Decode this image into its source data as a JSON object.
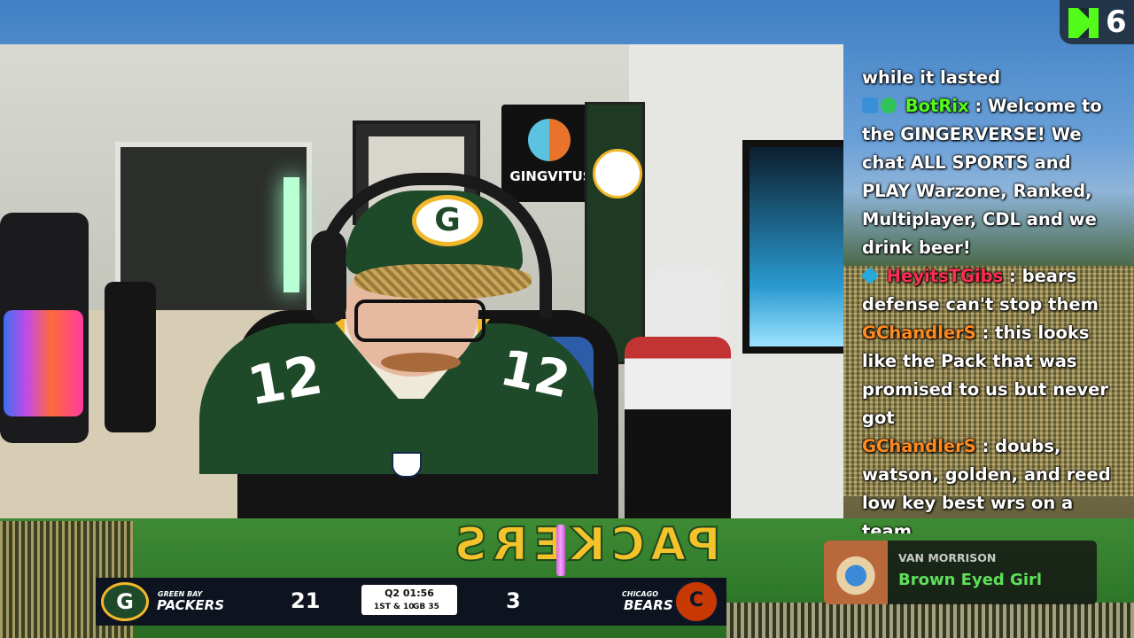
{
  "overlay": {
    "viewer_count": "6",
    "kick_logo": "K"
  },
  "chat": {
    "messages": [
      {
        "user": "",
        "text": "while it lasted",
        "user_color": "#ffffff"
      },
      {
        "user": "BotRix",
        "text": ": Welcome to the GINGERVERSE! We chat ALL SPORTS and PLAY Warzone, Ranked, Multiplayer, CDL and we drink beer!",
        "user_color": "#53fc18",
        "badges": [
          "mod-icon",
          "verified-icon"
        ]
      },
      {
        "user": "HeyitsTGibs",
        "text": ": bears defense can't stop them",
        "user_color": "#ff2d55",
        "badges": [
          "subscriber-icon"
        ]
      },
      {
        "user": "GChandlerS",
        "text": ": this looks like the Pack that was promised to us but never got",
        "user_color": "#ff8a1f"
      },
      {
        "user": "GChandlerS",
        "text": ": doubs, watson, golden, and reed low key best wrs on a team",
        "user_color": "#ff8a1f"
      }
    ]
  },
  "webcam": {
    "sign_text": "GINGVITUS",
    "jersey_number": "12",
    "cap_logo": "G",
    "banner_logo": "G"
  },
  "field": {
    "endzone_text": "PACKERS"
  },
  "scorebug": {
    "home": {
      "logo": "G",
      "city": "GREEN BAY",
      "name": "PACKERS",
      "score": "21"
    },
    "away": {
      "logo": "C",
      "city": "CHICAGO",
      "name": "BEARS",
      "score": "3"
    },
    "clock": "Q2 01:56",
    "down": "1ST & 10",
    "spot": "GB 35"
  },
  "now_playing": {
    "artist": "VAN MORRISON",
    "song": "Brown Eyed Girl"
  },
  "colors": {
    "packers_green": "#1f4a2a",
    "packers_gold": "#f3b82a",
    "kick_green": "#53fc18",
    "bears_orange": "#c83803"
  }
}
